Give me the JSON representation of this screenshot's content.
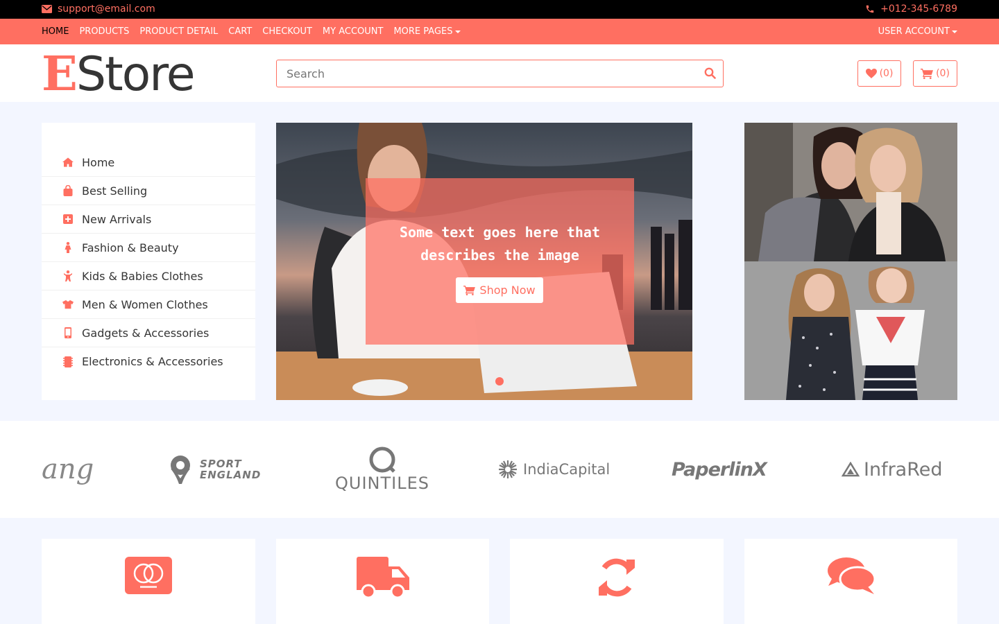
{
  "topbar": {
    "email": "support@email.com",
    "phone": "+012-345-6789"
  },
  "nav": {
    "links": [
      "HOME",
      "PRODUCTS",
      "PRODUCT DETAIL",
      "CART",
      "CHECKOUT",
      "MY ACCOUNT",
      "MORE PAGES"
    ],
    "active": "HOME",
    "user_account": "USER ACCOUNT"
  },
  "header": {
    "logo_first": "E",
    "logo_rest": "Store",
    "search_placeholder": "Search",
    "wishlist_count": "(0)",
    "cart_count": "(0)"
  },
  "sidebar": {
    "items": [
      {
        "label": "Home",
        "icon": "home-icon"
      },
      {
        "label": "Best Selling",
        "icon": "shopping-bag-icon"
      },
      {
        "label": "New Arrivals",
        "icon": "plus-square-icon"
      },
      {
        "label": "Fashion & Beauty",
        "icon": "female-icon"
      },
      {
        "label": "Kids & Babies Clothes",
        "icon": "child-icon"
      },
      {
        "label": "Men & Women Clothes",
        "icon": "tshirt-icon"
      },
      {
        "label": "Gadgets & Accessories",
        "icon": "mobile-icon"
      },
      {
        "label": "Electronics & Accessories",
        "icon": "microchip-icon"
      }
    ]
  },
  "slider": {
    "caption": "Some text goes here that describes the image",
    "button": "Shop Now"
  },
  "brands": {
    "items": [
      "ang",
      "SPORT ENGLAND",
      "QUINTILES",
      "IndiaCapital",
      "PaperlinX",
      "InfraRed"
    ]
  },
  "features": {
    "icons": [
      "credit-card-icon",
      "truck-icon",
      "sync-icon",
      "comments-icon"
    ]
  },
  "colors": {
    "accent": "#ff6f61",
    "topbar": "#000000",
    "page_bg": "#f3f6ff"
  }
}
